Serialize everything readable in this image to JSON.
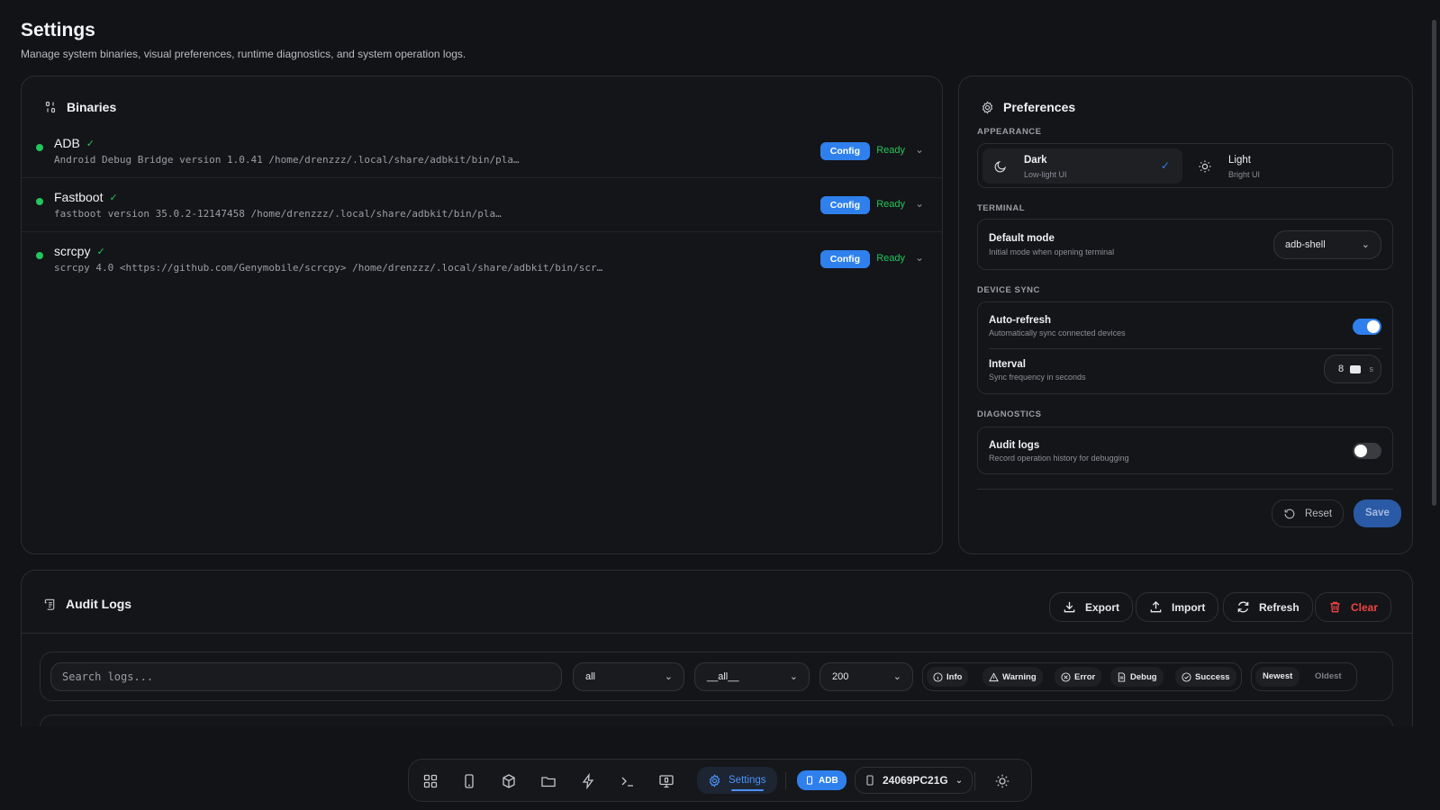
{
  "page": {
    "title": "Settings",
    "subtitle": "Manage system binaries, visual preferences, runtime diagnostics, and system operation logs."
  },
  "binaries": {
    "title": "Binaries",
    "items": [
      {
        "name": "ADB",
        "path": "Android Debug Bridge version 1.0.41 /home/drenzzz/.local/share/adbkit/bin/pla…",
        "config_label": "Config",
        "status": "Ready"
      },
      {
        "name": "Fastboot",
        "path": "fastboot version 35.0.2-12147458 /home/drenzzz/.local/share/adbkit/bin/pla…",
        "config_label": "Config",
        "status": "Ready"
      },
      {
        "name": "scrcpy",
        "path": "scrcpy 4.0 <https://github.com/Genymobile/scrcpy> /home/drenzzz/.local/share/adbkit/bin/scr…",
        "config_label": "Config",
        "status": "Ready"
      }
    ]
  },
  "preferences": {
    "title": "Preferences",
    "appearance": {
      "label": "APPEARANCE",
      "dark": {
        "title": "Dark",
        "sub": "Low-light UI",
        "selected": true
      },
      "light": {
        "title": "Light",
        "sub": "Bright UI",
        "selected": false
      }
    },
    "terminal": {
      "label": "TERMINAL",
      "default_mode": {
        "title": "Default mode",
        "sub": "Initial mode when opening terminal",
        "value": "adb-shell"
      }
    },
    "device_sync": {
      "label": "DEVICE SYNC",
      "auto_refresh": {
        "title": "Auto-refresh",
        "sub": "Automatically sync connected devices",
        "enabled": true
      },
      "interval": {
        "title": "Interval",
        "sub": "Sync frequency in seconds",
        "value": "8",
        "unit": "s"
      }
    },
    "diagnostics": {
      "label": "DIAGNOSTICS",
      "audit_logs": {
        "title": "Audit logs",
        "sub": "Record operation history for debugging",
        "enabled": false
      }
    },
    "reset_label": "Reset",
    "save_label": "Save"
  },
  "audit": {
    "title": "Audit Logs",
    "buttons": {
      "export": "Export",
      "import": "Import",
      "refresh": "Refresh",
      "clear": "Clear"
    },
    "search_placeholder": "Search logs...",
    "filters": {
      "level": "all",
      "source": "__all__",
      "limit": "200"
    },
    "levels": [
      "Info",
      "Warning",
      "Error",
      "Debug",
      "Success"
    ],
    "sort": {
      "newest": "Newest",
      "oldest": "Oldest",
      "active": "Newest"
    }
  },
  "dock": {
    "settings_label": "Settings",
    "adb_badge": "ADB",
    "device": "24069PC21G",
    "icons": [
      "dashboard-icon",
      "phone-icon",
      "package-icon",
      "folder-icon",
      "bolt-icon",
      "terminal-icon",
      "screen-mirror-icon",
      "gear-icon",
      "sun-icon"
    ]
  },
  "colors": {
    "accent": "#2f80ed",
    "ready": "#22c55e",
    "danger": "#ef4444",
    "background": "#121316"
  }
}
